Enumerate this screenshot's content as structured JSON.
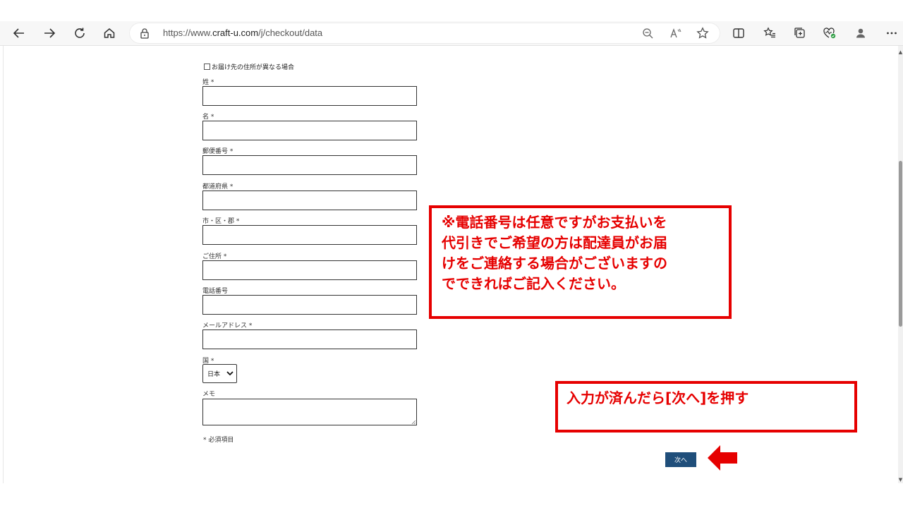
{
  "browser": {
    "url_prefix": "https://www.",
    "url_domain": "craft-u.com",
    "url_path": "/j/checkout/data",
    "icons": [
      "back-icon",
      "forward-icon",
      "refresh-icon",
      "home-icon",
      "lock-icon",
      "zoom-out-icon",
      "read-aloud-icon",
      "favorite-star-icon",
      "split-screen-icon",
      "favorites-icon",
      "collections-icon",
      "browser-essentials-icon",
      "profile-icon",
      "more-icon"
    ]
  },
  "form": {
    "diff_address_label": "お届け先の住所が異なる場合",
    "fields": [
      {
        "label": "姓 *",
        "value": ""
      },
      {
        "label": "名 *",
        "value": ""
      },
      {
        "label": "郵便番号 *",
        "value": ""
      },
      {
        "label": "都道府県 *",
        "value": ""
      },
      {
        "label": "市・区・郡 *",
        "value": ""
      },
      {
        "label": "ご住所 *",
        "value": ""
      },
      {
        "label": "電話番号",
        "value": ""
      },
      {
        "label": "メールアドレス *",
        "value": ""
      }
    ],
    "country_label": "国 *",
    "country_value": "日本",
    "memo_label": "メモ",
    "memo_value": "",
    "required_note": "* 必須項目",
    "next_label": "次へ"
  },
  "annotations": {
    "callout1_lines": [
      "※電話番号は任意ですがお支払いを",
      "代引きでご希望の方は配達員がお届",
      "けをご連絡する場合がございますの",
      "でできればご記入ください。"
    ],
    "callout2": "入力が済んだら[次へ]を押す",
    "accent_color": "#e60000",
    "button_color": "#1f4e7a"
  }
}
